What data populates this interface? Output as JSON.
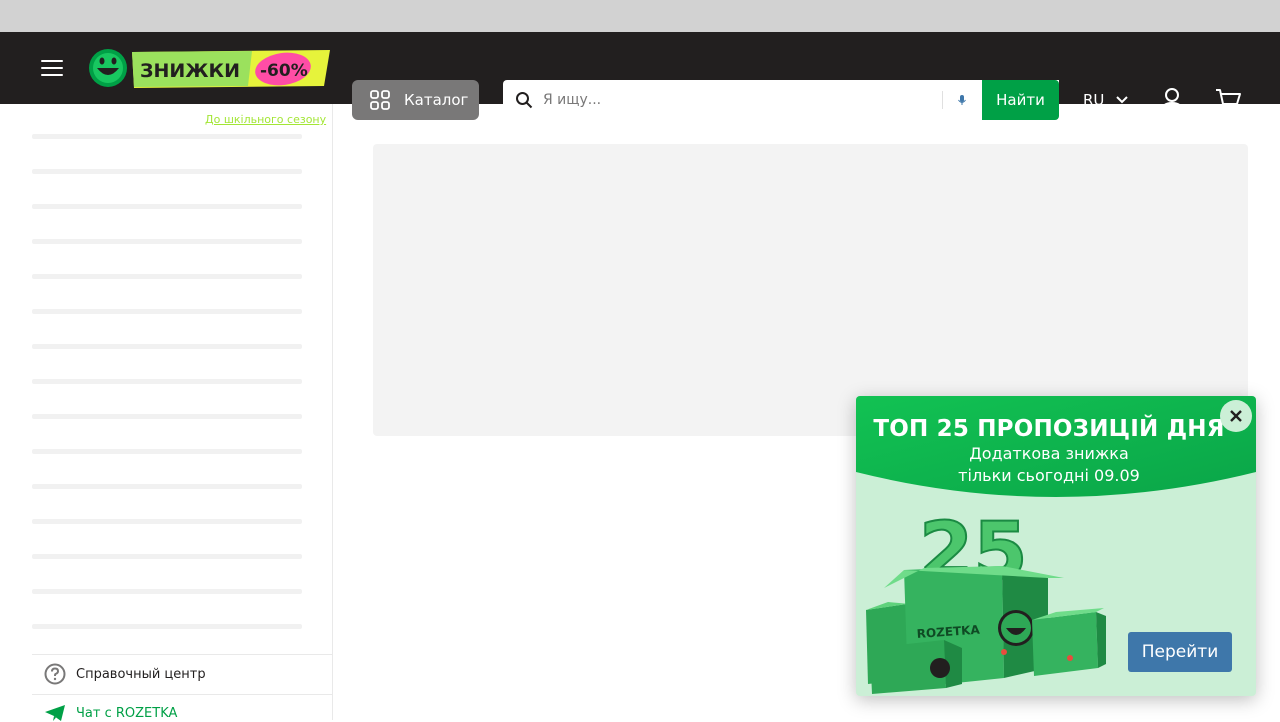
{
  "header": {
    "logo": {
      "badge_text": "ЗНИЖКИ",
      "discount": "-60%",
      "subtitle": "До шкільного сезону"
    },
    "catalog_label": "Каталог",
    "search": {
      "placeholder": "Я ищу..."
    },
    "find_label": "Найти",
    "language": "RU",
    "icons": [
      "menu-icon",
      "catalog-grid-icon",
      "search-icon",
      "microphone-icon",
      "chevron-down-icon",
      "user-icon",
      "cart-icon"
    ]
  },
  "sidebar": {
    "help_center": "Справочный центр",
    "chat": "Чат с ROZETKA",
    "icons": [
      "question-circle-icon",
      "telegram-icon"
    ]
  },
  "popup": {
    "title": "ТОП 25 ПРОПОЗИЦІЙ ДНЯ",
    "subtitle_line1": "Додаткова знижка",
    "subtitle_line2": "тільки сьогодні 09.09",
    "number": "25",
    "box_brand": "ROZETKA",
    "go_label": "Перейти",
    "icons": [
      "close-icon"
    ]
  },
  "colors": {
    "header_bg": "#221f1f",
    "brand_green": "#00a046",
    "catalog_bg": "#797878",
    "popup_button": "#3e77aa",
    "chat_link": "#00a046"
  }
}
